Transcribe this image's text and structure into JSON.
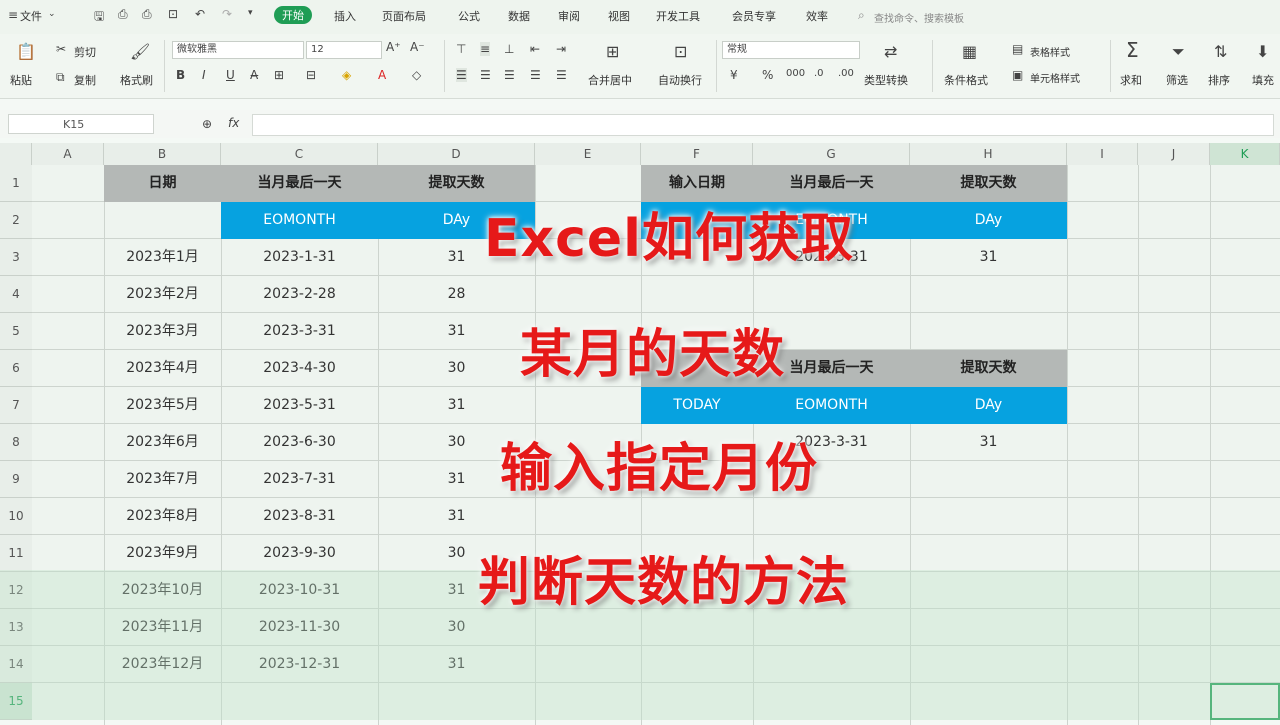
{
  "menu": {
    "file": "文件",
    "tabs": [
      "开始",
      "插入",
      "页面布局",
      "公式",
      "数据",
      "审阅",
      "视图",
      "开发工具",
      "会员专享",
      "效率"
    ],
    "search_placeholder": "查找命令、搜索模板"
  },
  "toolbar": {
    "paste": "粘贴",
    "cut": "剪切",
    "copy": "复制",
    "format_painter": "格式刷",
    "font_name": "微软雅黑",
    "font_size": "12",
    "merge_center": "合并居中",
    "auto_wrap": "自动换行",
    "number_format": "常规",
    "type_convert": "类型转换",
    "conditional_format": "条件格式",
    "table_style": "表格样式",
    "cell_style": "单元格样式",
    "sum": "求和",
    "filter": "筛选",
    "sort": "排序",
    "fill": "填充"
  },
  "formula": {
    "cell_ref": "K15",
    "fx": "fx"
  },
  "columns": [
    "A",
    "B",
    "C",
    "D",
    "E",
    "F",
    "G",
    "H",
    "I",
    "J",
    "K"
  ],
  "rows": [
    "1",
    "2",
    "3",
    "4",
    "5",
    "6",
    "7",
    "8",
    "9",
    "10",
    "11",
    "12",
    "13",
    "14",
    "15"
  ],
  "table_left": {
    "headers": [
      "日期",
      "当月最后一天",
      "提取天数"
    ],
    "functions": [
      "EOMONTH",
      "DAy"
    ],
    "data": [
      [
        "2023年1月",
        "2023-1-31",
        "31"
      ],
      [
        "2023年2月",
        "2023-2-28",
        "28"
      ],
      [
        "2023年3月",
        "2023-3-31",
        "31"
      ],
      [
        "2023年4月",
        "2023-4-30",
        "30"
      ],
      [
        "2023年5月",
        "2023-5-31",
        "31"
      ],
      [
        "2023年6月",
        "2023-6-30",
        "30"
      ],
      [
        "2023年7月",
        "2023-7-31",
        "31"
      ],
      [
        "2023年8月",
        "2023-8-31",
        "31"
      ],
      [
        "2023年9月",
        "2023-9-30",
        "30"
      ],
      [
        "2023年10月",
        "2023-10-31",
        "31"
      ],
      [
        "2023年11月",
        "2023-11-30",
        "30"
      ],
      [
        "2023年12月",
        "2023-12-31",
        "31"
      ]
    ]
  },
  "table_right_top": {
    "headers": [
      "输入日期",
      "当月最后一天",
      "提取天数"
    ],
    "functions": [
      "EOMONTH",
      "DAy"
    ],
    "data": [
      "2023-3-31",
      "31"
    ]
  },
  "table_right_bottom": {
    "headers": [
      "当月最后一天",
      "提取天数"
    ],
    "functions": [
      "TODAY",
      "EOMONTH",
      "DAy"
    ],
    "data": [
      "2023-3-31",
      "31"
    ]
  },
  "caption": [
    "Excel如何获取",
    "某月的天数",
    "输入指定月份",
    "判断天数的方法"
  ],
  "colors": {
    "accent_green": "#1f9d55",
    "header_gray": "#b4b8b6",
    "function_blue": "#06a2e0",
    "caption_red": "#e61919"
  }
}
